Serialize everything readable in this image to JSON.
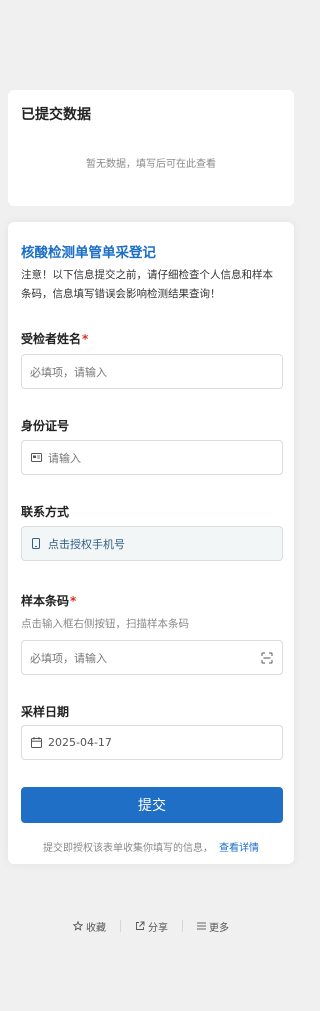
{
  "submitted": {
    "title": "已提交数据",
    "empty_text": "暂无数据，填写后可在此查看"
  },
  "form": {
    "title": "核酸检测单管单采登记",
    "notice": "注意！以下信息提交之前，请仔细检查个人信息和样本条码，信息填写错误会影响检测结果查询！",
    "fields": {
      "name": {
        "label": "受检者姓名",
        "required_mark": "*",
        "placeholder": "必填项，请输入"
      },
      "id_number": {
        "label": "身份证号",
        "placeholder": "请输入",
        "icon": "id-card-icon"
      },
      "contact": {
        "label": "联系方式",
        "button_text": "点击授权手机号",
        "icon": "phone-icon"
      },
      "barcode": {
        "label": "样本条码",
        "required_mark": "*",
        "hint": "点击输入框右侧按钮，扫描样本条码",
        "placeholder": "必填项，请输入",
        "icon": "scan-icon"
      },
      "date": {
        "label": "采样日期",
        "value": "2025-04-17",
        "icon": "calendar-icon"
      }
    },
    "submit_label": "提交",
    "footnote": "提交即授权该表单收集你填写的信息，",
    "footnote_link": "查看详情"
  },
  "bottom_bar": {
    "favorite": "收藏",
    "share": "分享",
    "more": "更多"
  },
  "colors": {
    "accent": "#1f6fc6",
    "title_blue": "#1a6ec7",
    "required": "#d93025",
    "page_bg": "#f0f0f1"
  }
}
